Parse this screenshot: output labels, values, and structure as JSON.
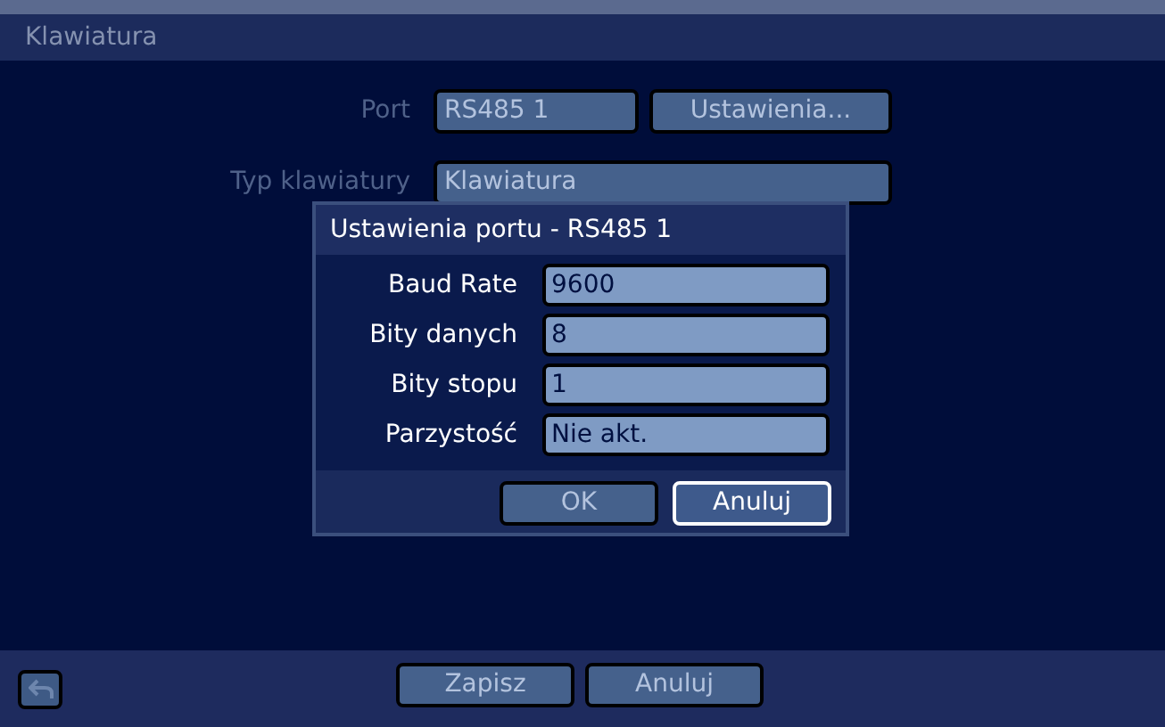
{
  "window": {
    "title": "Klawiatura"
  },
  "settings": [
    {
      "label": "Port",
      "value": "RS485 1",
      "button": "Ustawienia...",
      "disabled": true
    },
    {
      "label": "Typ klawiatury",
      "value": "Klawiatura",
      "disabled": true
    }
  ],
  "dialog": {
    "title": "Ustawienia portu - RS485 1",
    "fields": [
      {
        "label": "Baud Rate",
        "value": "9600"
      },
      {
        "label": "Bity danych",
        "value": "8"
      },
      {
        "label": "Bity stopu",
        "value": "1"
      },
      {
        "label": "Parzystość",
        "value": "Nie akt."
      }
    ],
    "buttons": [
      {
        "label": "OK",
        "disabled": true,
        "focused": false
      },
      {
        "label": "Anuluj",
        "disabled": false,
        "focused": true
      }
    ]
  },
  "footer": {
    "buttons": [
      {
        "label": "Zapisz",
        "disabled": true
      },
      {
        "label": "Anuluj",
        "disabled": true
      }
    ]
  }
}
